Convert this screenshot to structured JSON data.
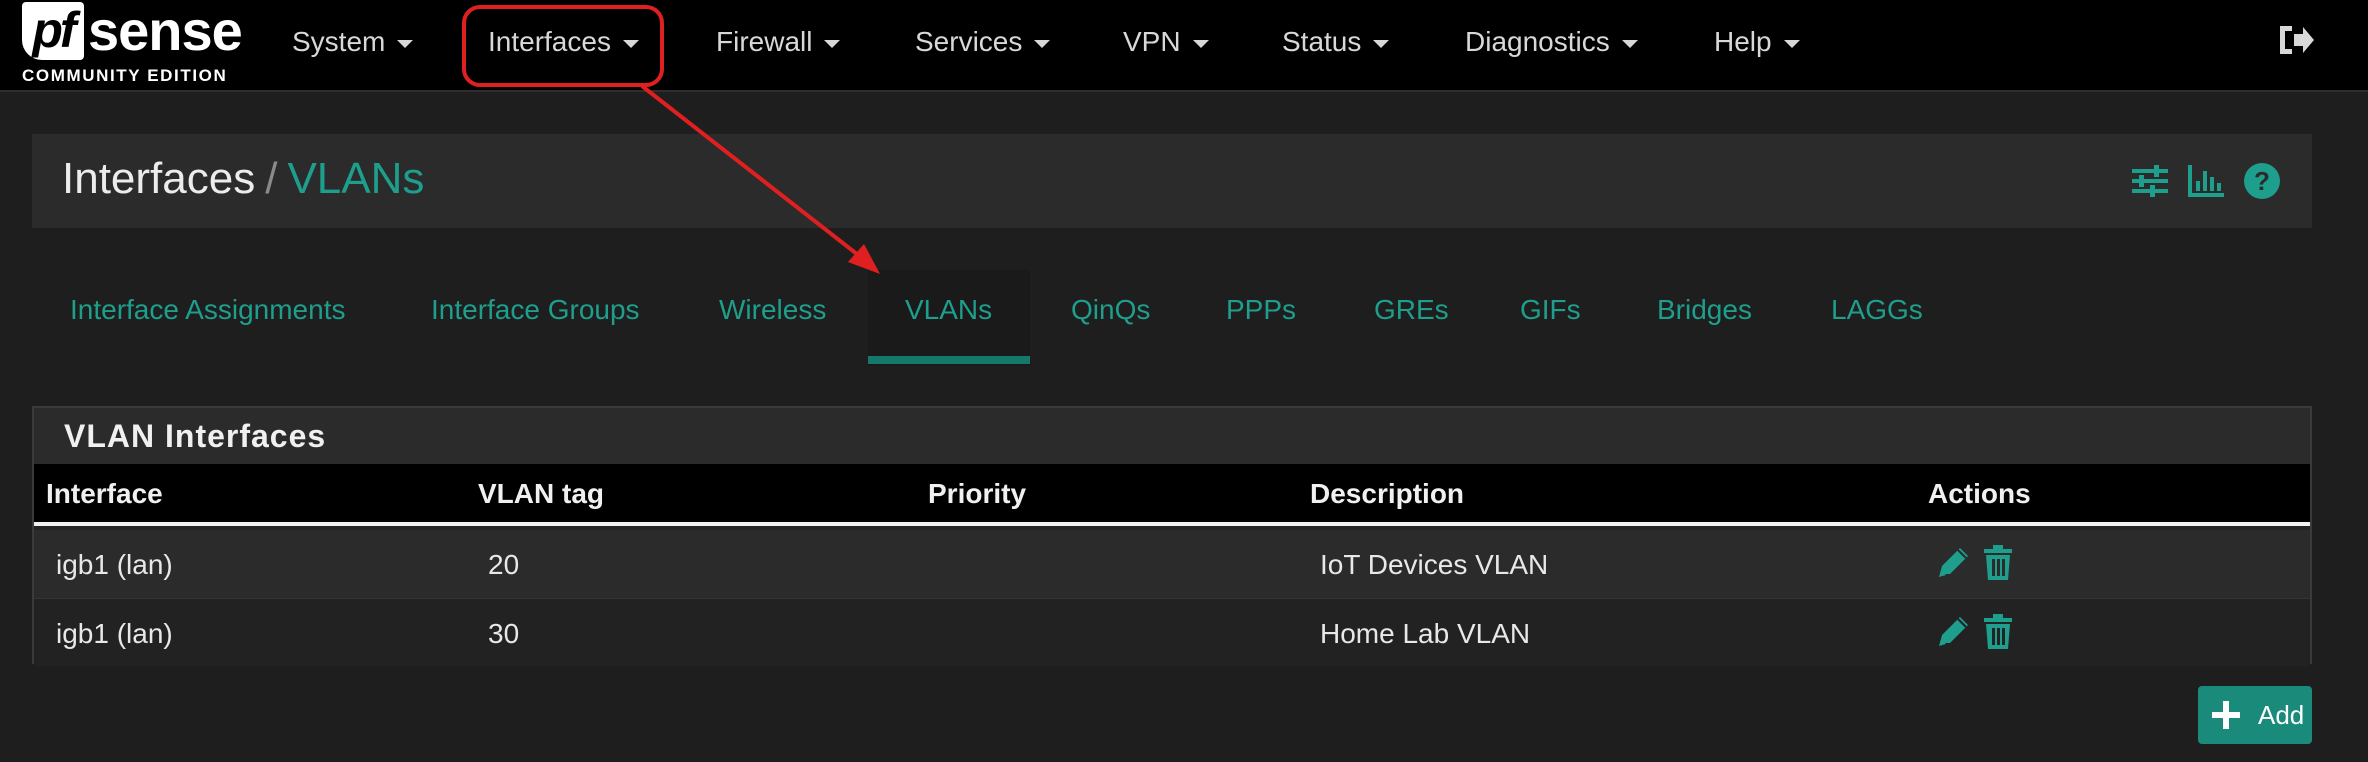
{
  "brand": {
    "logo_pf": "pf",
    "logo_sense": "sense",
    "edition": "COMMUNITY EDITION"
  },
  "nav": {
    "items": [
      "System",
      "Interfaces",
      "Firewall",
      "Services",
      "VPN",
      "Status",
      "Diagnostics",
      "Help"
    ],
    "highlighted": "Interfaces",
    "logout_icon": "logout-icon"
  },
  "breadcrumb": {
    "parent": "Interfaces",
    "separator": "/",
    "current": "VLANs"
  },
  "header_icons": [
    "sliders-icon",
    "bar-chart-icon",
    "help-icon"
  ],
  "tabs": {
    "items": [
      "Interface Assignments",
      "Interface Groups",
      "Wireless",
      "VLANs",
      "QinQs",
      "PPPs",
      "GREs",
      "GIFs",
      "Bridges",
      "LAGGs"
    ],
    "active": "VLANs"
  },
  "table": {
    "title": "VLAN Interfaces",
    "columns": [
      "Interface",
      "VLAN tag",
      "Priority",
      "Description",
      "Actions"
    ],
    "rows": [
      {
        "interface": "igb1 (lan)",
        "vlan_tag": "20",
        "priority": "",
        "description": "IoT Devices VLAN"
      },
      {
        "interface": "igb1 (lan)",
        "vlan_tag": "30",
        "priority": "",
        "description": "Home Lab VLAN"
      }
    ]
  },
  "add_button": {
    "label": "Add"
  },
  "colors": {
    "accent": "#1e9e8c",
    "annotation": "#e02020",
    "background": "#1e1e1e"
  }
}
